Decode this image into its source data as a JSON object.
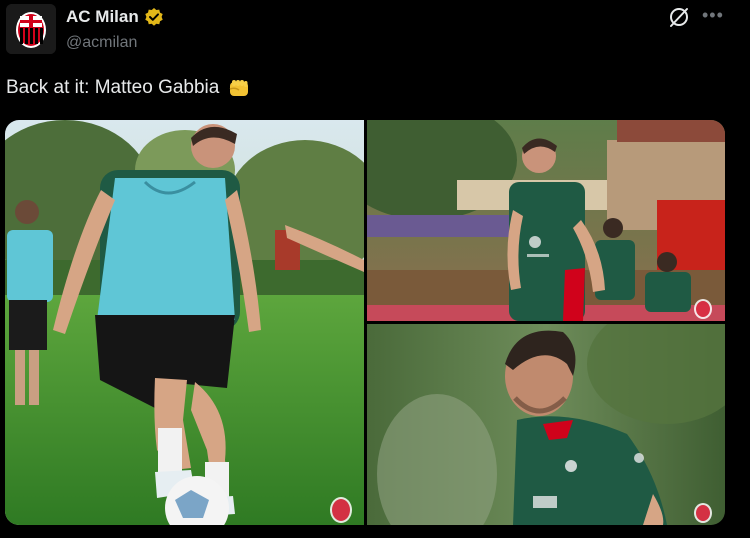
{
  "account": {
    "display_name": "AC Milan",
    "handle": "@acmilan",
    "verified": true,
    "avatar_icon": "ac-milan-crest-icon"
  },
  "header_actions": {
    "grok_icon": "grok-icon",
    "more_icon": "more-options-icon",
    "more_label": "•••"
  },
  "tweet": {
    "text": "Back at it: Matteo Gabbia",
    "emoji": "👊"
  },
  "media": {
    "count": 3,
    "photos": [
      {
        "name": "photo-training-ball",
        "subject": "player in cyan training bib with ball"
      },
      {
        "name": "photo-training-group",
        "subject": "player in green training kit with teammates"
      },
      {
        "name": "photo-closeup",
        "subject": "close-up of player in green training kit"
      }
    ]
  },
  "colors": {
    "background": "#000000",
    "text_primary": "#e7e9ea",
    "text_secondary": "#71767b",
    "verified_gold": "#e2b719",
    "milan_red": "#d0021b",
    "kit_green": "#1f5a44",
    "bib_cyan": "#5fc6d6",
    "pitch_green": "#3f8a2f"
  }
}
